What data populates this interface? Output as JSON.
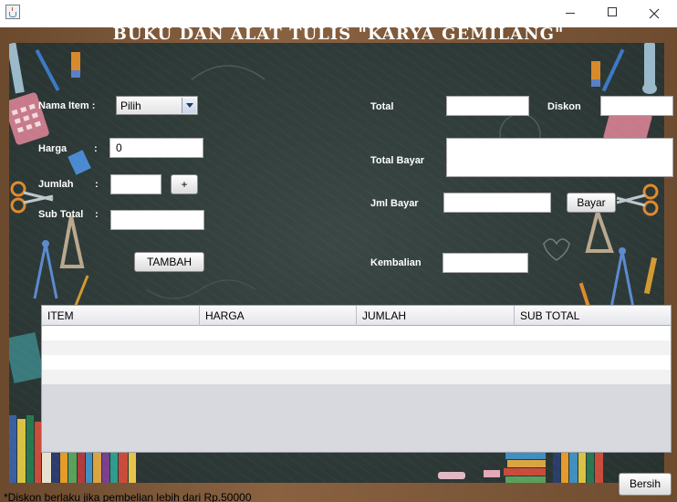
{
  "window": {
    "icon": "java-cup-icon",
    "controls": {
      "minimize": "minimize-icon",
      "maximize": "maximize-icon",
      "close": "close-icon"
    }
  },
  "heading": "BUKU DAN ALAT TULIS \"KARYA GEMILANG\"",
  "form": {
    "nama_item_label": "Nama Item :",
    "nama_item_selected": "Pilih",
    "harga_label": "Harga",
    "harga_value": "0",
    "jumlah_label": "Jumlah",
    "plus_button": "+",
    "subtotal_label": "Sub Total",
    "colon": ":",
    "tambah_button": "TAMBAH"
  },
  "summary": {
    "total_label": "Total",
    "total_value": "",
    "diskon_label": "Diskon",
    "diskon_value": "",
    "total_bayar_label": "Total Bayar",
    "total_bayar_value": "",
    "jml_bayar_label": "Jml Bayar",
    "jml_bayar_value": "",
    "bayar_button": "Bayar",
    "kembalian_label": "Kembalian",
    "kembalian_value": ""
  },
  "table": {
    "columns": [
      "ITEM",
      "HARGA",
      "JUMLAH",
      "SUB TOTAL"
    ],
    "rows": []
  },
  "footer": {
    "note": "*Diskon berlaku jika pembelian lebih dari Rp.50000",
    "bersih_button": "Bersih"
  },
  "colors": {
    "board": "#2e3a38",
    "frame": "#7a5638",
    "chalk": "#ffffff"
  }
}
